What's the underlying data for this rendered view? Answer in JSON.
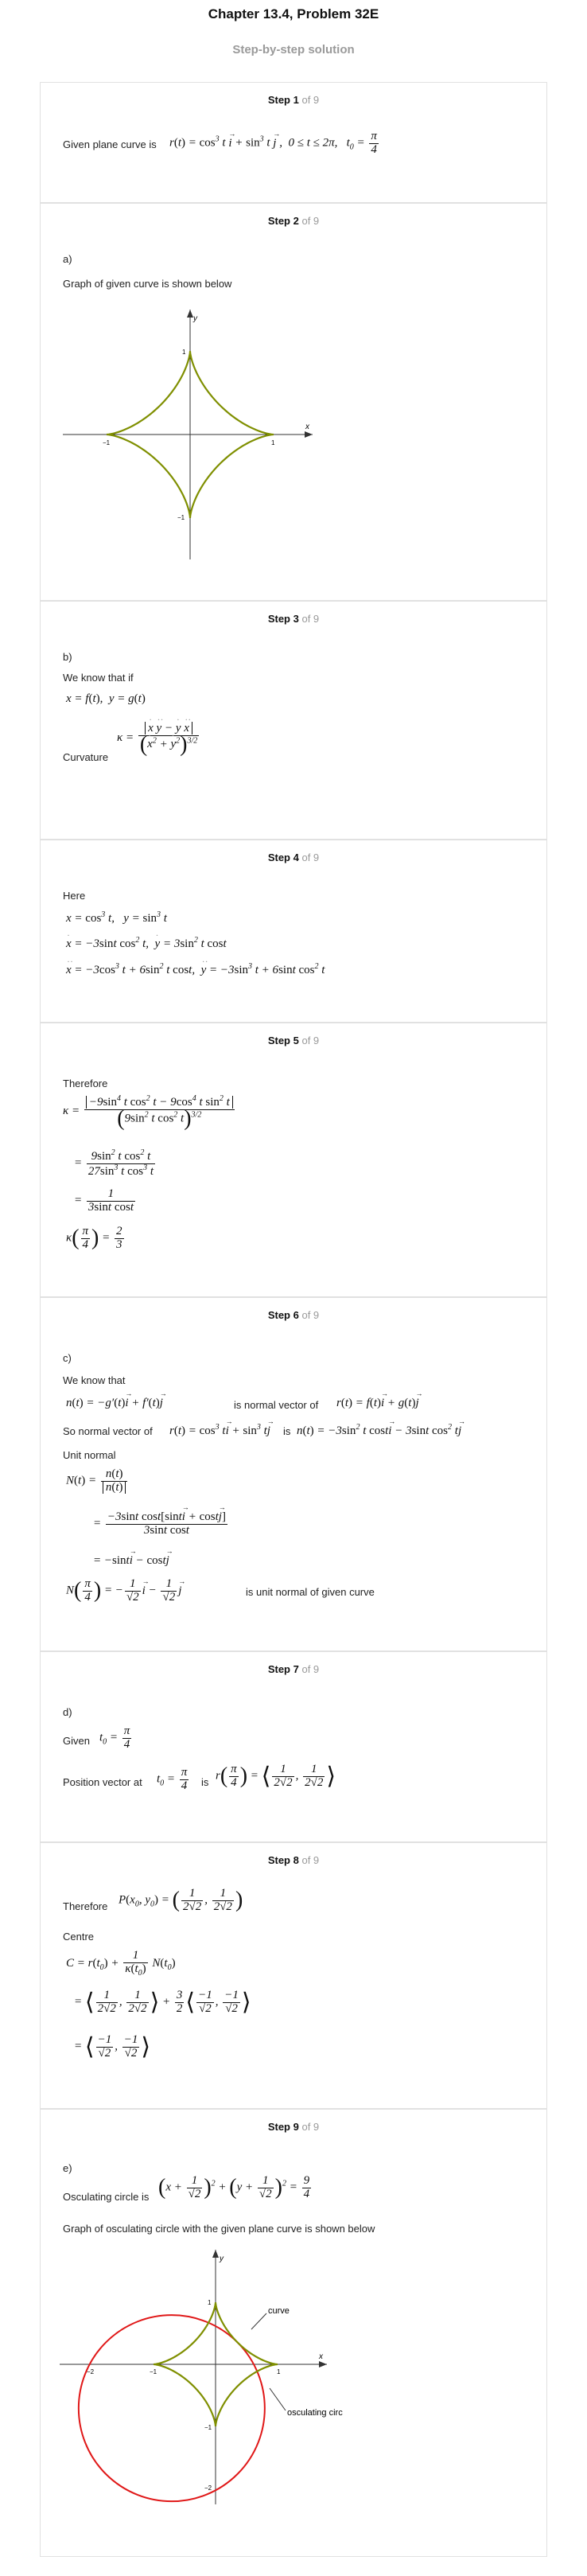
{
  "header": {
    "title": "Chapter 13.4, Problem 32E",
    "subtitle": "Step-by-step solution"
  },
  "steps": [
    {
      "n": "Step 1",
      "of": "of 9"
    },
    {
      "n": "Step 2",
      "of": "of 9"
    },
    {
      "n": "Step 3",
      "of": "of 9"
    },
    {
      "n": "Step 4",
      "of": "of 9"
    },
    {
      "n": "Step 5",
      "of": "of 9"
    },
    {
      "n": "Step 6",
      "of": "of 9"
    },
    {
      "n": "Step 7",
      "of": "of 9"
    },
    {
      "n": "Step 8",
      "of": "of 9"
    },
    {
      "n": "Step 9",
      "of": "of 9"
    }
  ],
  "text": {
    "s1_given": "Given plane curve is",
    "s2_part": "a)",
    "s2_graph": "Graph of given curve is shown below",
    "s3_part": "b)",
    "s3_know": "We know that if",
    "s3_curv": "Curvature",
    "s4_here": "Here",
    "s5_therefore": "Therefore",
    "s6_part": "c)",
    "s6_know": "We know that",
    "s6_isnormal": "is normal vector of",
    "s6_so": "So normal vector of",
    "s6_is": "is",
    "s6_unit": "Unit normal",
    "s6_isunit": "is unit normal of given curve",
    "s7_part": "d)",
    "s7_given": "Given",
    "s7_pos": "Position vector at",
    "s7_is": "is",
    "s8_therefore": "Therefore",
    "s8_centre": "Centre",
    "s9_part": "e)",
    "s9_osc": "Osculating circle is",
    "s9_graph": "Graph of osculating circle with the given plane curve is shown below"
  },
  "graph1": {
    "labels": {
      "y": "y",
      "x": "x",
      "one_y": "1",
      "neg_one_y": "−1",
      "one_x": "1",
      "neg_one_x": "−1"
    },
    "curve_color": "#7f8f00",
    "axis_color": "#333333"
  },
  "graph2": {
    "labels": {
      "y": "y",
      "x": "x",
      "one_y": "1",
      "neg_one_y": "−1",
      "neg_two_y": "−2",
      "one_x": "1",
      "neg_one_x": "−1",
      "neg_two_x": "−2",
      "curve": "curve",
      "osc": "osculating circle"
    },
    "curve_color": "#7f8f00",
    "circle_color": "#e01818",
    "axis_color": "#333333",
    "circle": {
      "center_x": -0.7071,
      "center_y": -0.7071,
      "radius": 1.5
    }
  }
}
